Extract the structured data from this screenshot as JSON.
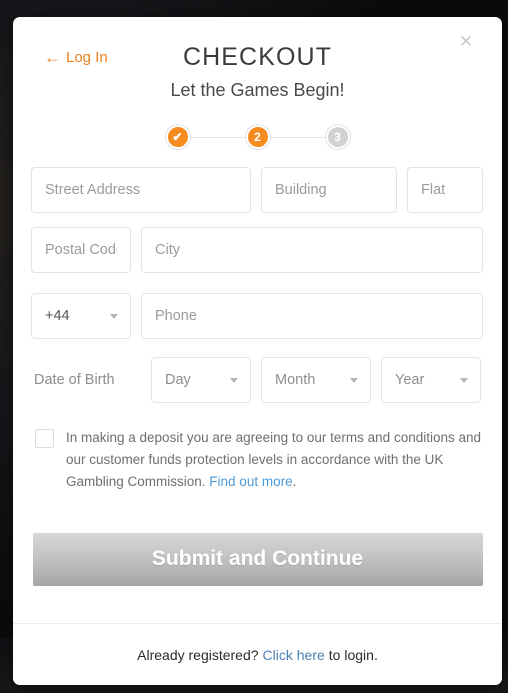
{
  "header": {
    "back_link": "Log In",
    "back_arrow_icon": "arrow-left-icon",
    "close_icon": "close-icon",
    "title": "CHECKOUT",
    "subtitle": "Let the Games Begin!"
  },
  "steps": [
    {
      "label": "✔",
      "state": "done"
    },
    {
      "label": "2",
      "state": "active"
    },
    {
      "label": "3",
      "state": "todo"
    }
  ],
  "form": {
    "street_placeholder": "Street Address",
    "building_placeholder": "Building",
    "flat_placeholder": "Flat",
    "postal_placeholder": "Postal Code",
    "city_placeholder": "City",
    "country_code_value": "+44",
    "phone_placeholder": "Phone",
    "dob_label": "Date of Birth",
    "dob_day": "Day",
    "dob_month": "Month",
    "dob_year": "Year"
  },
  "terms": {
    "text_part1": "In making a deposit you are agreeing to our terms and conditions and our customer funds protection levels in accordance with the UK Gambling Commission. ",
    "link": "Find out more",
    "text_part2": "."
  },
  "submit": {
    "label": "Submit and Continue"
  },
  "footer": {
    "prefix": "Already registered?",
    "link": "Click here",
    "suffix": "to login."
  },
  "colors": {
    "accent": "#f68b1f",
    "link_blue": "#4d9ad8",
    "footer_link": "#4d7fb5",
    "step_inactive": "#d2d2d2"
  }
}
